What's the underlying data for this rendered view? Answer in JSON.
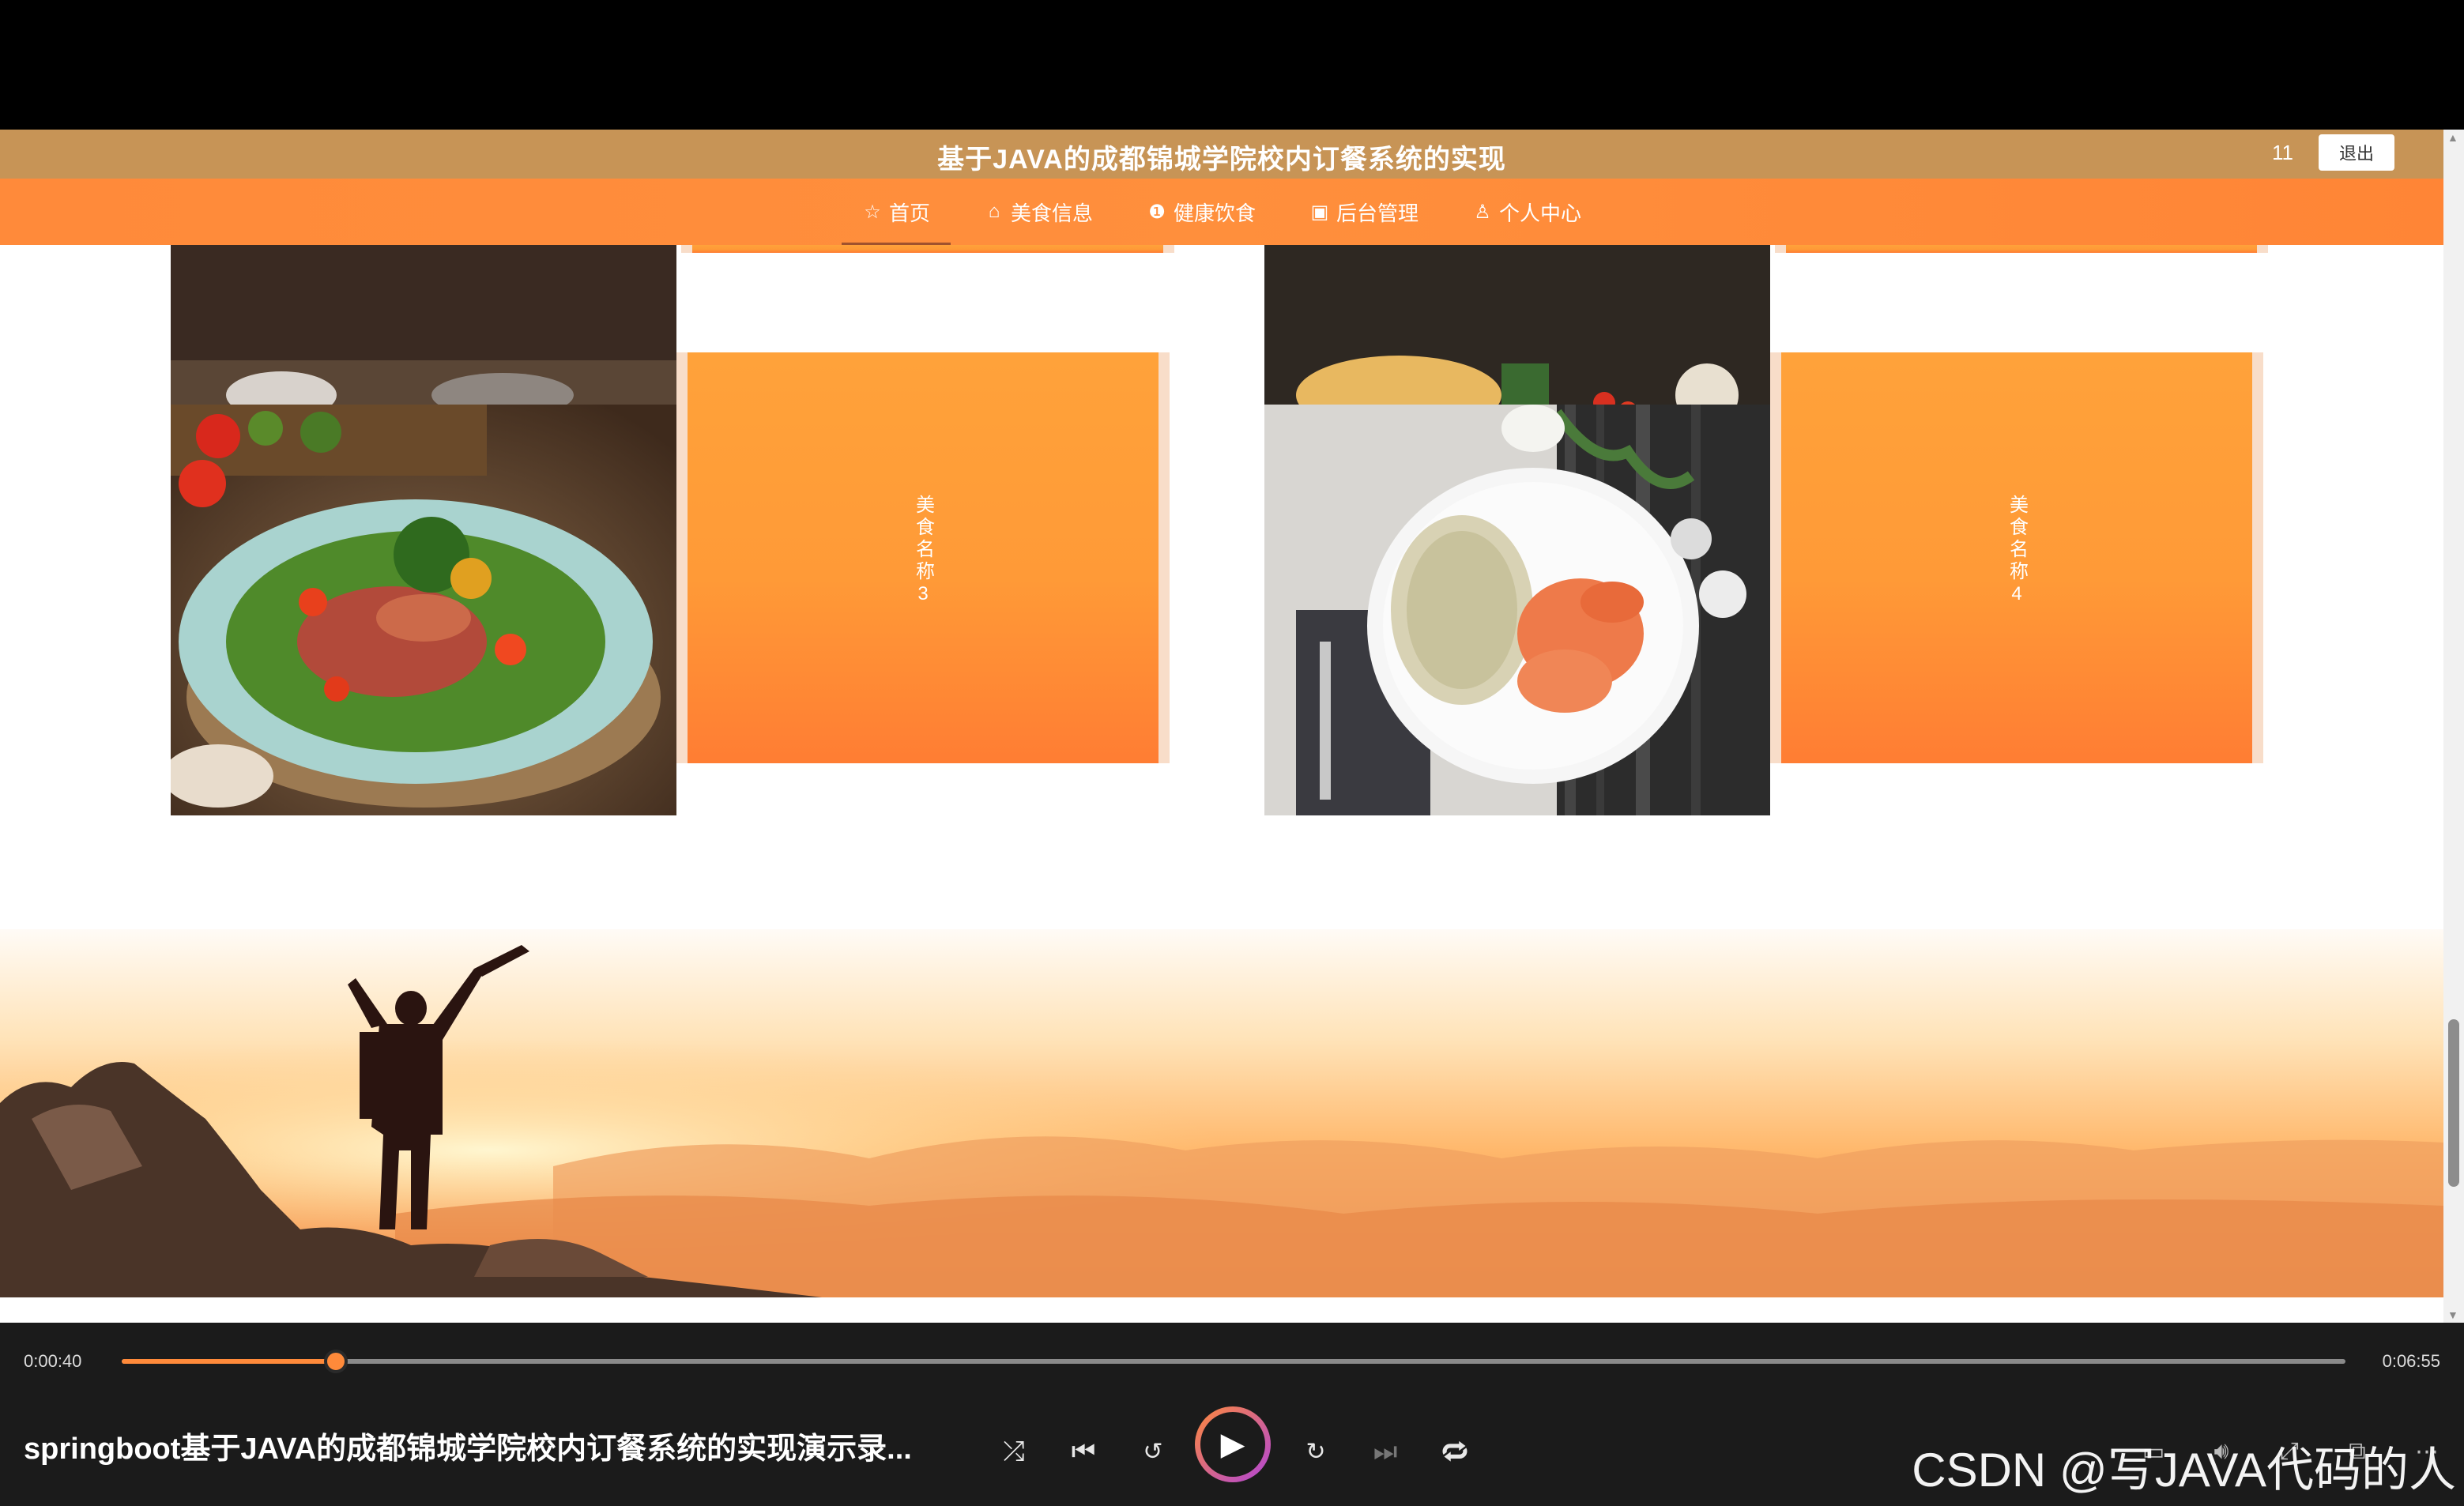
{
  "site": {
    "title": "基于JAVA的成都锦城学院校内订餐系统的实现",
    "username": "11",
    "logout_label": "退出"
  },
  "nav": {
    "items": [
      {
        "label": "首页",
        "icon": "star-icon",
        "glyph": "☆"
      },
      {
        "label": "美食信息",
        "icon": "bag-icon",
        "glyph": "⌂"
      },
      {
        "label": "健康饮食",
        "icon": "info-icon",
        "glyph": "❶"
      },
      {
        "label": "后台管理",
        "icon": "briefcase-icon",
        "glyph": "▣"
      },
      {
        "label": "个人中心",
        "icon": "user-icon",
        "glyph": "♙"
      }
    ],
    "active_index": 0
  },
  "foods": [
    {
      "name": "美食名称3",
      "image": "steak-salad"
    },
    {
      "name": "美食名称4",
      "image": "shrimp-rice"
    }
  ],
  "player": {
    "current_time": "0:00:40",
    "total_time": "0:06:55",
    "progress": 0.0964,
    "video_title": "springboot基于JAVA的成都锦城学院校内订餐系统的实现演示录...",
    "accent_color": "#ff8a3a"
  },
  "watermark": "CSDN @写JAVA代码的人"
}
